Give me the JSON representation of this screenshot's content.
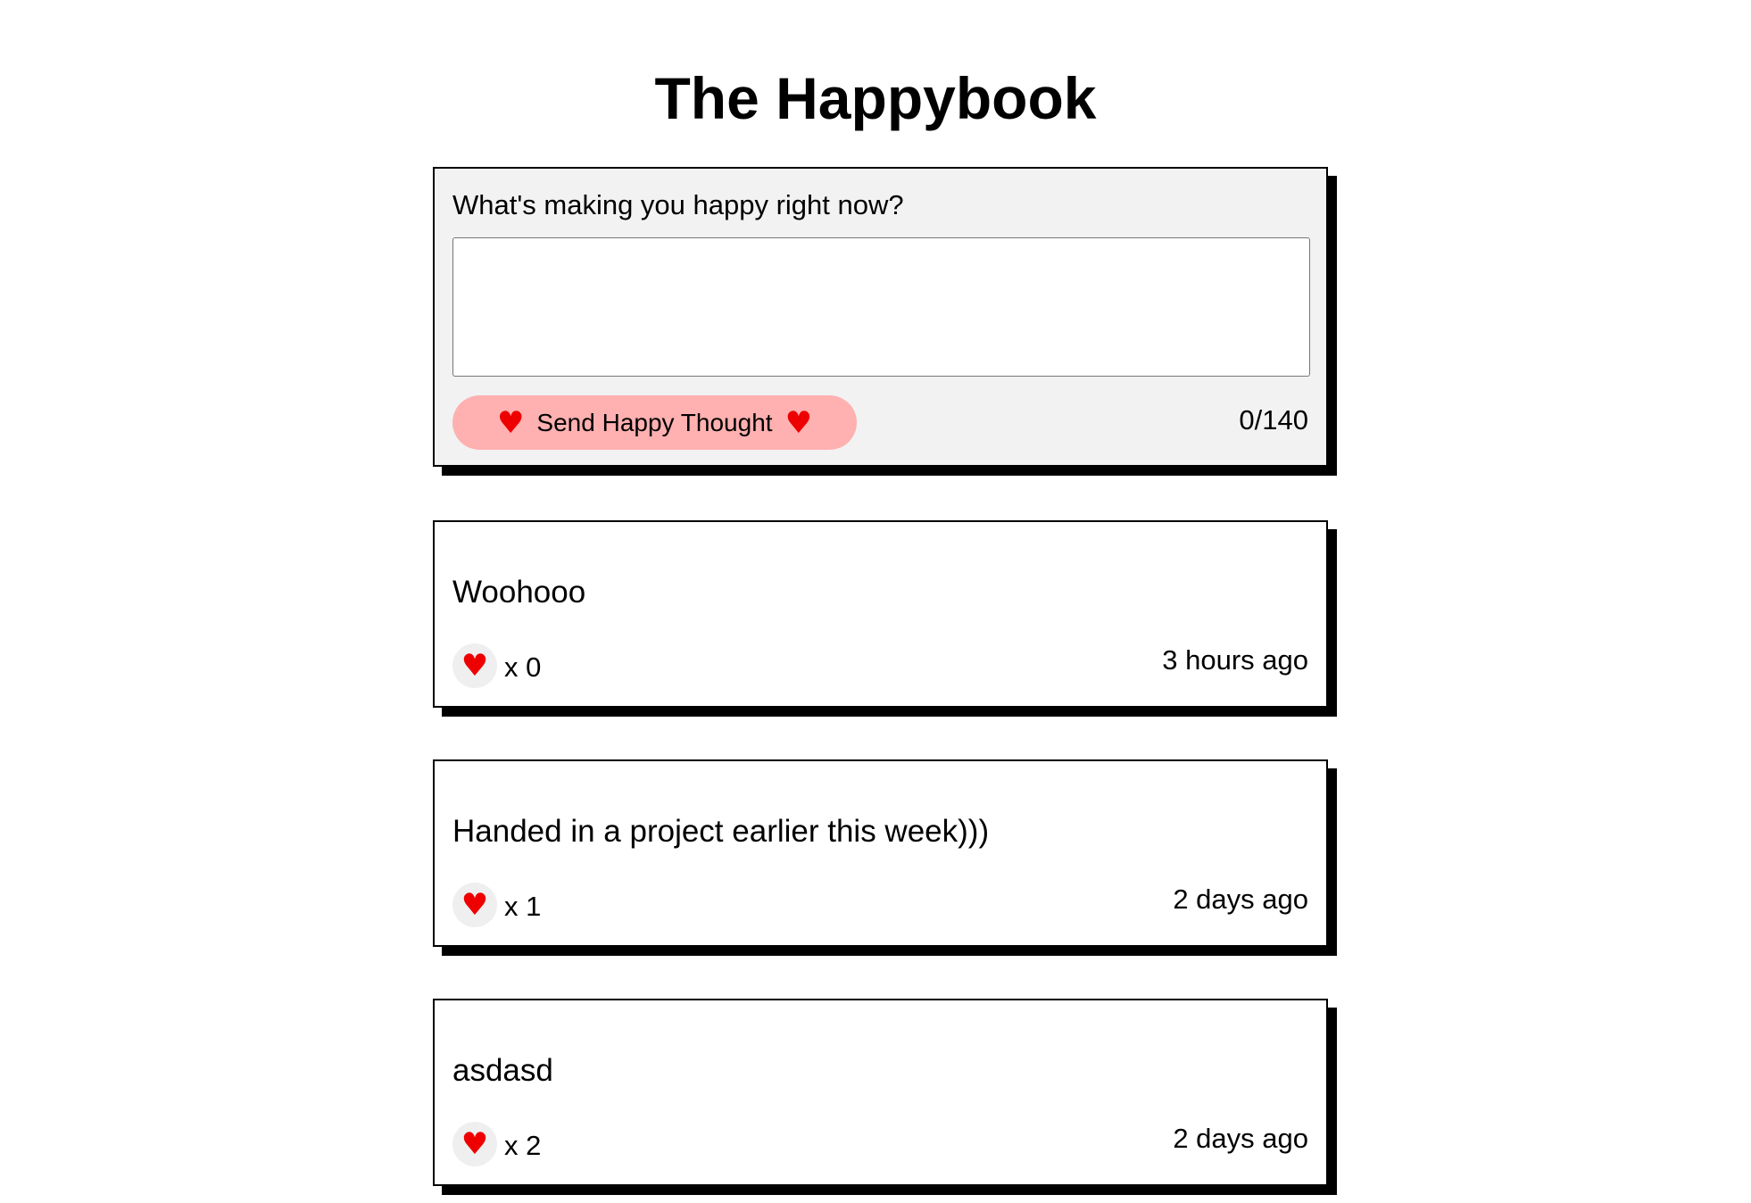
{
  "app": {
    "title": "The Happybook"
  },
  "composer": {
    "prompt": "What's making you happy right now?",
    "input_value": "",
    "input_placeholder": "",
    "send_label": "Send Happy Thought",
    "heart_glyph": "♥",
    "char_count": "0/140"
  },
  "thoughts": [
    {
      "message": "Woohooo",
      "likes": "x 0",
      "time": "3 hours ago",
      "heart": "♥"
    },
    {
      "message": "Handed in a project earlier this week)))",
      "likes": "x 1",
      "time": "2 days ago",
      "heart": "♥"
    },
    {
      "message": "asdasd",
      "likes": "x 2",
      "time": "2 days ago",
      "heart": "♥"
    }
  ],
  "colors": {
    "accent_pink": "#ffb0b0",
    "heart_red": "#ee0000",
    "composer_bg": "#f2f2f2",
    "like_button_bg": "#efefef",
    "shadow": "#000000"
  },
  "icons": {
    "heart": "heart-icon"
  }
}
